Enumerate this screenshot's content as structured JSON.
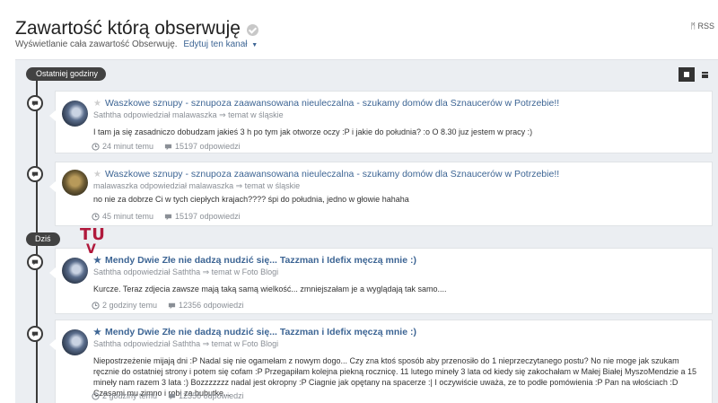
{
  "header": {
    "title": "Zawartość którą obserwuję",
    "subtitle": "Wyświetlanie cała zawartość Obserwuję.",
    "edit_link": "Edytuj ten kanał",
    "rss": "RSS"
  },
  "sections": {
    "recent": "Ostatniej godziny",
    "today": "Dziś"
  },
  "annotation": {
    "tu": "TU",
    "v": "V"
  },
  "items": [
    {
      "title": "Waszkowe sznupy - sznupoza zaawansowana nieuleczalna - szukamy domów dla Sznaucerów w Potrzebie!!",
      "meta": "Saththa odpowiedział malawaszka ⇒ temat w śląskie",
      "body": "I tam ja się zasadniczo dobudzam jakieś 3 h po tym jak otworze oczy :P i jakie do południa? :o O 8.30 juz jestem w pracy :)",
      "time": "24 minut temu",
      "replies": "15197 odpowiedzi"
    },
    {
      "title": "Waszkowe sznupy - sznupoza zaawansowana nieuleczalna - szukamy domów dla Sznaucerów w Potrzebie!!",
      "meta": "malawaszka odpowiedział malawaszka ⇒ temat w śląskie",
      "body": "no nie za dobrze Ci w tych ciepłych krajach???? śpi do południa, jedno w głowie hahaha",
      "time": "45 minut temu",
      "replies": "15197 odpowiedzi"
    },
    {
      "title": "Mendy Dwie Złe nie dadzą nudzić się... Tazzman i Idefix męczą mnie :)",
      "meta": "Saththa odpowiedział Saththa ⇒ temat w Foto Blogi",
      "body": "Kurcze. Teraz zdjecia zawsze mają taką samą wielkość... zmniejszałam je a wyglądają tak samo....",
      "time": "2 godziny temu",
      "replies": "12356 odpowiedzi"
    },
    {
      "title": "Mendy Dwie Złe nie dadzą nudzić się... Tazzman i Idefix męczą mnie :)",
      "meta": "Saththa odpowiedział Saththa ⇒ temat w Foto Blogi",
      "body": "Niepostrzeżenie mijają dni :P  Nadal się nie ogamełam z nowym dogo...  Czy zna ktoś sposób aby przenosiło do 1 nieprzeczytanego postu? No nie moge jak szukam ręcznie do ostatniej strony i potem się cofam :P  Przegapiłam kolejna piekną rocznicę. 11 lutego mineły 3 lata od kiedy się zakochałam w Małej Białej MyszoMendzie a 15 mineły nam razem 3 lata :) Bozzzzzzz nadal jest okropny :P Ciagnie jak opętany na spacerze :|  I oczywiście uważa, ze to podłe pomówienia :P  Pan na włościach :D  Czasami mu zimno i robi za bubutke...",
      "time": "2 godziny temu",
      "replies": "12356 odpowiedzi"
    }
  ]
}
